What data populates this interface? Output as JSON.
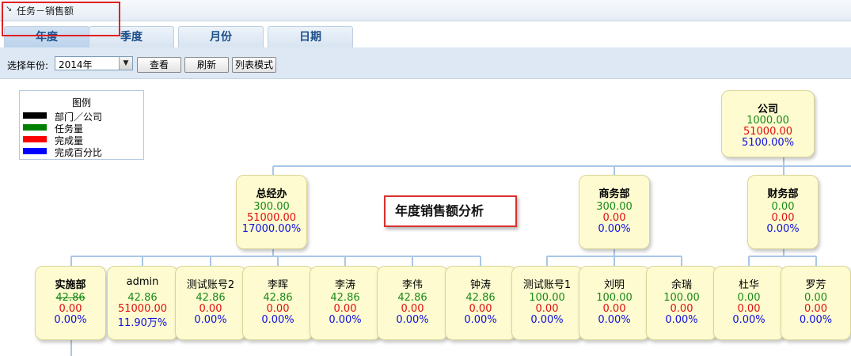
{
  "window": {
    "title": "任务－销售额"
  },
  "tabs": [
    {
      "label": "年度"
    },
    {
      "label": "季度"
    },
    {
      "label": "月份"
    },
    {
      "label": "日期"
    }
  ],
  "toolbar": {
    "year_label": "选择年份:",
    "year_value": "2014年",
    "view_button": "查看",
    "refresh_button": "刷新",
    "list_mode_button": "列表模式"
  },
  "legend": {
    "title": "图例",
    "items": [
      {
        "label": "部门／公司",
        "color": "#000000"
      },
      {
        "label": "任务量",
        "color": "#008000"
      },
      {
        "label": "完成量",
        "color": "#ff0000"
      },
      {
        "label": "完成百分比",
        "color": "#0000ff"
      }
    ]
  },
  "chart_title": "年度销售额分析",
  "colors": {
    "task": "#1a8a1a",
    "done": "#e01010",
    "percent": "#1010e0",
    "node_bg": "#fdfbcf"
  },
  "org": {
    "company": {
      "name": "公司",
      "task": "1000.00",
      "done": "51000.00",
      "percent": "5100.00%"
    },
    "departments": [
      {
        "name": "总经办",
        "task": "300.00",
        "done": "51000.00",
        "percent": "17000.00%"
      },
      {
        "name": "商务部",
        "task": "300.00",
        "done": "0.00",
        "percent": "0.00%"
      },
      {
        "name": "财务部",
        "task": "0.00",
        "done": "0.00",
        "percent": "0.00%"
      }
    ],
    "members": [
      {
        "name": "实施部",
        "task": "42.86",
        "done": "0.00",
        "percent": "0.00%"
      },
      {
        "name": "admin",
        "task": "42.86",
        "done": "51000.00",
        "percent": "11.90万%"
      },
      {
        "name": "测试账号2",
        "task": "42.86",
        "done": "0.00",
        "percent": "0.00%"
      },
      {
        "name": "李晖",
        "task": "42.86",
        "done": "0.00",
        "percent": "0.00%"
      },
      {
        "name": "李涛",
        "task": "42.86",
        "done": "0.00",
        "percent": "0.00%"
      },
      {
        "name": "李伟",
        "task": "42.86",
        "done": "0.00",
        "percent": "0.00%"
      },
      {
        "name": "钟涛",
        "task": "42.86",
        "done": "0.00",
        "percent": "0.00%"
      },
      {
        "name": "测试账号1",
        "task": "100.00",
        "done": "0.00",
        "percent": "0.00%"
      },
      {
        "name": "刘明",
        "task": "100.00",
        "done": "0.00",
        "percent": "0.00%"
      },
      {
        "name": "余瑞",
        "task": "100.00",
        "done": "0.00",
        "percent": "0.00%"
      },
      {
        "name": "杜华",
        "task": "0.00",
        "done": "0.00",
        "percent": "0.00%"
      },
      {
        "name": "罗芳",
        "task": "0.00",
        "done": "0.00",
        "percent": "0.00%"
      }
    ]
  }
}
